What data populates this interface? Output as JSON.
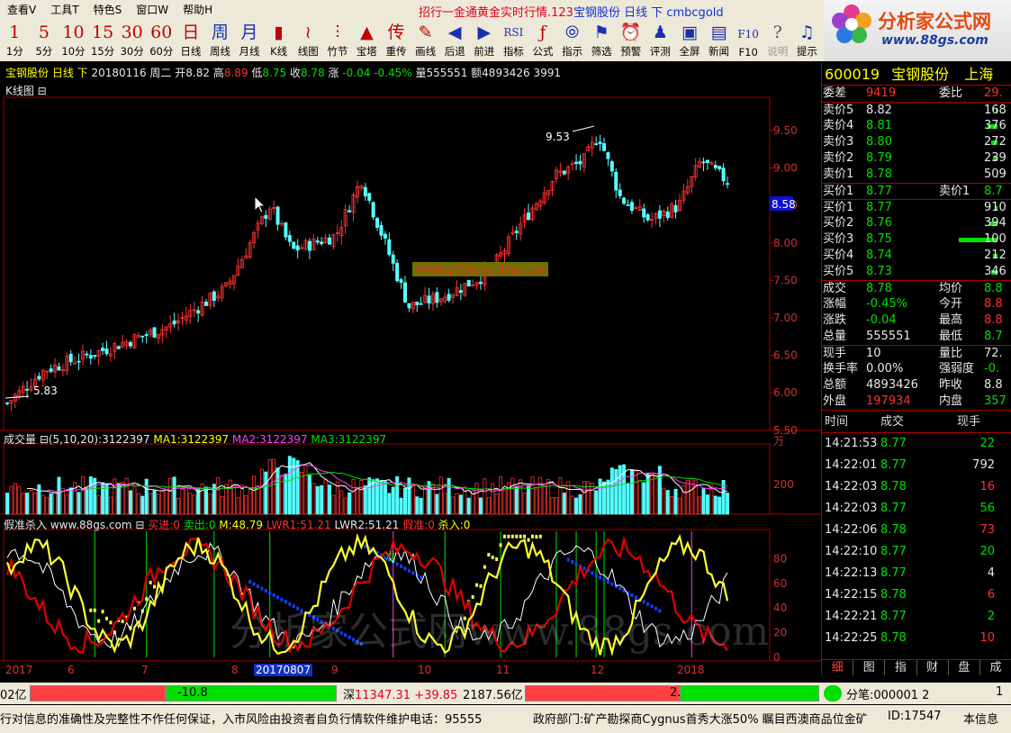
{
  "menu": {
    "items": [
      "查看V",
      "工具T",
      "特色S",
      "窗口W",
      "帮助H"
    ],
    "ticker_red": "招行一金通黄金实时行情.123",
    "ticker_blue": "宝钢股份 日线 下 cmbcgold"
  },
  "toolbar": [
    {
      "icon": "1",
      "label": "1分"
    },
    {
      "icon": "5",
      "label": "5分"
    },
    {
      "icon": "10",
      "label": "10分"
    },
    {
      "icon": "15",
      "label": "15分"
    },
    {
      "icon": "30",
      "label": "30分"
    },
    {
      "icon": "60",
      "label": "60分"
    },
    {
      "icon": "日",
      "label": "日线"
    },
    {
      "icon": "周",
      "label": "周线",
      "blue": true
    },
    {
      "icon": "月",
      "label": "月线",
      "blue": true
    },
    {
      "icon": "▮",
      "label": "K线"
    },
    {
      "icon": "≀",
      "label": "线图"
    },
    {
      "icon": "⫶",
      "label": "竹节"
    },
    {
      "icon": "▲",
      "label": "宝塔"
    },
    {
      "icon": "传",
      "label": "重传"
    },
    {
      "icon": "✎",
      "label": "画线"
    },
    {
      "icon": "◀",
      "label": "后退",
      "blue": true
    },
    {
      "icon": "▶",
      "label": "前进",
      "blue": true
    },
    {
      "icon": "RSI",
      "label": "指标",
      "blue": true
    },
    {
      "icon": "ƒ",
      "label": "公式"
    },
    {
      "icon": "⦾",
      "label": "指示",
      "blue": true
    },
    {
      "icon": "⚑",
      "label": "筛选",
      "blue": true
    },
    {
      "icon": "⏰",
      "label": "预警"
    },
    {
      "icon": "♟",
      "label": "评测",
      "blue": true
    },
    {
      "icon": "▣",
      "label": "全屏",
      "blue": true
    },
    {
      "icon": "▤",
      "label": "新闻",
      "blue": true
    },
    {
      "icon": "F10",
      "label": "F10",
      "blue": true
    },
    {
      "icon": "?",
      "label": "说明",
      "gray": true,
      "disabled": true
    },
    {
      "icon": "♫",
      "label": "提示",
      "blue": true
    }
  ],
  "logo": {
    "title": "分析家公式网",
    "url": "www.88gs.com"
  },
  "info": {
    "name": "宝钢股份",
    "period": "日线 下",
    "date": "20180116 周二",
    "open_label": "开",
    "open": "8.82",
    "high_label": "高",
    "high": "8.89",
    "low_label": "低",
    "low": "8.75",
    "close_label": "收",
    "close": "8.78",
    "chg_label": "涨",
    "chg": "-0.04",
    "pct": "-0.45%",
    "vol_label": "量",
    "vol": "555551",
    "amt_label": "额",
    "amt": "4893426",
    "extra": "3991"
  },
  "kline": {
    "label": "K线图 ⊟",
    "hi": "9.53",
    "lo": "5.83",
    "tag": "8.58",
    "watermark": "分析家公式网www.88gs.com"
  },
  "volume_header": {
    "label": "成交量 ⊟(5,10,20)",
    "val": ":3122397",
    "ma1": "MA1:3122397",
    "ma2": "MA2:3122397",
    "ma3": "MA3:3122397",
    "unit": "万"
  },
  "indicator_header": {
    "label": "假准杀入 www.88gs.com ⊟",
    "buy": "买进:0",
    "sell": "卖出:0",
    "m": "M:48.79",
    "lwr1": "LWR1:51.21",
    "lwr2": "LWR2:51.21",
    "fake": "假准:0",
    "kill": "杀入:0",
    "mark": "准",
    "watermark": "分析家公式网www.88gs.com"
  },
  "axis": {
    "price": [
      "9.50",
      "9.00",
      "8.50",
      "8.00",
      "7.50",
      "7.00",
      "6.50",
      "6.00",
      "5.50"
    ],
    "volume": [
      "200"
    ],
    "indicator": [
      "80",
      "60",
      "40",
      "20",
      "0"
    ],
    "dates": [
      "2017",
      "6",
      "7",
      "8",
      "20170807",
      "9",
      "10",
      "11",
      "12",
      "2018"
    ]
  },
  "quote": {
    "code": "600019",
    "name": "宝钢股份",
    "market": "上海",
    "weicha_label": "委差",
    "weicha": "9419",
    "weibi_label": "委比",
    "weibi": "29.",
    "sells": [
      {
        "l": "卖价5",
        "p": "8.82",
        "v": "168",
        "w": 0.05
      },
      {
        "l": "卖价4",
        "p": "8.81",
        "v": "376",
        "w": 0.25
      },
      {
        "l": "卖价3",
        "p": "8.80",
        "v": "272",
        "w": 0.15
      },
      {
        "l": "卖价2",
        "p": "8.79",
        "v": "239",
        "w": 0.12
      },
      {
        "l": "卖价1",
        "p": "8.78",
        "v": "509",
        "w": 0.03
      }
    ],
    "buy1_label": "买价1",
    "buy1": "8.77",
    "sell1_label": "卖价1",
    "sell1": "8.7",
    "buys": [
      {
        "l": "买价1",
        "p": "8.77",
        "v": "910",
        "w": 0.07
      },
      {
        "l": "买价2",
        "p": "8.76",
        "v": "394",
        "w": 0.2
      },
      {
        "l": "买价3",
        "p": "8.75",
        "v": "100",
        "w": 0.95
      },
      {
        "l": "买价4",
        "p": "8.74",
        "v": "212",
        "w": 0.12
      },
      {
        "l": "买价5",
        "p": "8.73",
        "v": "346",
        "w": 0.16
      }
    ],
    "stats": [
      {
        "l": "成交",
        "v": "8.78",
        "l2": "均价",
        "v2": "8.8",
        "c": "grn",
        "c2": "grn"
      },
      {
        "l": "涨幅",
        "v": "-0.45%",
        "l2": "今开",
        "v2": "8.8",
        "c": "grn",
        "c2": "red"
      },
      {
        "l": "涨跌",
        "v": "-0.04",
        "l2": "最高",
        "v2": "8.8",
        "c": "grn",
        "c2": "red"
      },
      {
        "l": "总量",
        "v": "555551",
        "l2": "最低",
        "v2": "8.7",
        "c": "wht",
        "c2": "grn"
      },
      {
        "l": "现手",
        "v": "10",
        "l2": "量比",
        "v2": "72.",
        "c": "wht",
        "c2": "wht"
      },
      {
        "l": "换手率",
        "v": "0.00%",
        "l2": "强弱度",
        "v2": "-0.",
        "c": "wht",
        "c2": "grn"
      },
      {
        "l": "总额",
        "v": "4893426",
        "l2": "昨收",
        "v2": "8.8",
        "c": "wht",
        "c2": "wht"
      },
      {
        "l": "外盘",
        "v": "197934",
        "l2": "内盘",
        "v2": "357",
        "c": "red",
        "c2": "grn"
      }
    ],
    "tick_headers": [
      "时间",
      "成交",
      "现手"
    ],
    "ticks": [
      {
        "t": "14:21:53",
        "p": "8.77",
        "v": "22",
        "pc": "grn",
        "vc": "grn"
      },
      {
        "t": "14:22:01",
        "p": "8.77",
        "v": "792",
        "pc": "grn",
        "vc": "wht"
      },
      {
        "t": "14:22:03",
        "p": "8.78",
        "v": "16",
        "pc": "grn",
        "vc": "red"
      },
      {
        "t": "14:22:03",
        "p": "8.77",
        "v": "56",
        "pc": "grn",
        "vc": "grn"
      },
      {
        "t": "14:22:06",
        "p": "8.78",
        "v": "73",
        "pc": "grn",
        "vc": "red"
      },
      {
        "t": "14:22:10",
        "p": "8.77",
        "v": "20",
        "pc": "grn",
        "vc": "grn"
      },
      {
        "t": "14:22:13",
        "p": "8.77",
        "v": "4",
        "pc": "grn",
        "vc": "wht"
      },
      {
        "t": "14:22:15",
        "p": "8.78",
        "v": "6",
        "pc": "grn",
        "vc": "red"
      },
      {
        "t": "14:22:21",
        "p": "8.77",
        "v": "2",
        "pc": "grn",
        "vc": "grn"
      },
      {
        "t": "14:22:25",
        "p": "8.78",
        "v": "10",
        "pc": "grn",
        "vc": "red"
      }
    ],
    "tabs": [
      "细",
      "图",
      "指",
      "财",
      "盘",
      "成"
    ]
  },
  "status": {
    "left": "02亿",
    "bar1": "-10.8",
    "sz_label": "深",
    "sz": "11347.31",
    "sz_chg": "+39.85",
    "sz_amt": "2187.56亿",
    "bar2": "2.5",
    "fenbi": "分笔:000001 2",
    "one": "1",
    "notice": "行对信息的准确性及完整性不作任何保证，入市风险由投资者自负行情软件维护电话：95555",
    "news": "政府部门:矿产勘探商Cygnus首秀大涨50% 瞩目西澳商品位金矿",
    "id": "ID:17547",
    "tail": "本信息"
  }
}
